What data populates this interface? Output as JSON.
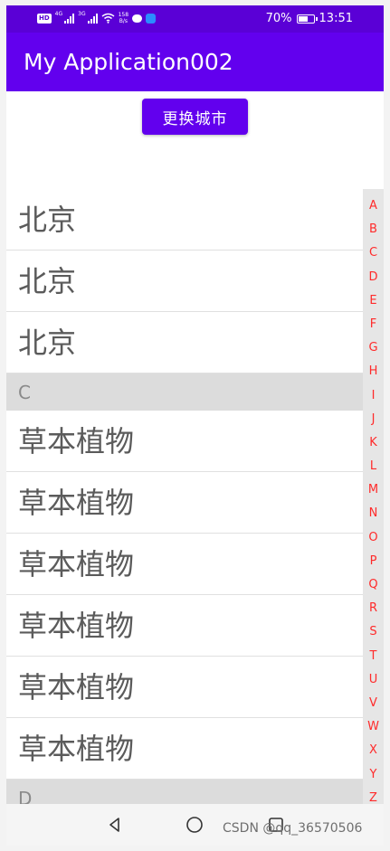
{
  "status_bar": {
    "hd_badge": "HD",
    "network_sup_1": "4G",
    "network_sup_2": "3G",
    "speed_value": "158",
    "speed_unit": "B/s",
    "battery_percent": "70%",
    "battery_level": 0.7,
    "time": "13:51"
  },
  "app_bar": {
    "title": "My Application002"
  },
  "actions": {
    "change_city_label": "更换城市"
  },
  "list": {
    "items": [
      {
        "type": "item",
        "label": "北京"
      },
      {
        "type": "item",
        "label": "北京"
      },
      {
        "type": "item",
        "label": "北京"
      },
      {
        "type": "header",
        "label": "C"
      },
      {
        "type": "item",
        "label": "草本植物"
      },
      {
        "type": "item",
        "label": "草本植物"
      },
      {
        "type": "item",
        "label": "草本植物"
      },
      {
        "type": "item",
        "label": "草本植物"
      },
      {
        "type": "item",
        "label": "草本植物"
      },
      {
        "type": "item",
        "label": "草本植物"
      },
      {
        "type": "header",
        "label": "D"
      }
    ]
  },
  "index_bar": {
    "letters": [
      "A",
      "B",
      "C",
      "D",
      "E",
      "F",
      "G",
      "H",
      "I",
      "J",
      "K",
      "L",
      "M",
      "N",
      "O",
      "P",
      "Q",
      "R",
      "S",
      "T",
      "U",
      "V",
      "W",
      "X",
      "Y",
      "Z"
    ],
    "color": "#ff2a2a"
  },
  "nav_bar": {
    "icons": [
      "back-icon",
      "home-icon",
      "recent-apps-icon"
    ]
  },
  "watermark": "CSDN @qq_36570506",
  "colors": {
    "primary": "#6200ee",
    "status_bar": "#5a00d6"
  }
}
